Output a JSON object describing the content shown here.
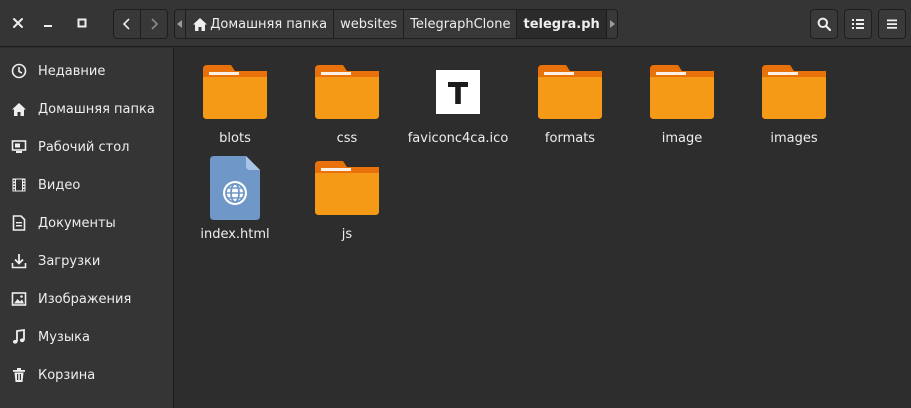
{
  "window": {
    "close_icon": "close-icon",
    "minimize_icon": "minimize-icon",
    "maximize_icon": "maximize-icon"
  },
  "pathbar": {
    "crumbs": [
      {
        "label": "Домашняя папка",
        "icon": "home-icon"
      },
      {
        "label": "websites"
      },
      {
        "label": "TelegraphClone"
      },
      {
        "label": "telegra.ph"
      }
    ]
  },
  "sidebar": {
    "items": [
      {
        "label": "Недавние",
        "icon": "recent-icon"
      },
      {
        "label": "Домашняя папка",
        "icon": "home-icon"
      },
      {
        "label": "Рабочий стол",
        "icon": "desktop-icon"
      },
      {
        "label": "Видео",
        "icon": "video-icon"
      },
      {
        "label": "Документы",
        "icon": "documents-icon"
      },
      {
        "label": "Загрузки",
        "icon": "downloads-icon"
      },
      {
        "label": "Изображения",
        "icon": "pictures-icon"
      },
      {
        "label": "Музыка",
        "icon": "music-icon"
      },
      {
        "label": "Корзина",
        "icon": "trash-icon"
      }
    ]
  },
  "files": [
    {
      "name": "blots",
      "type": "folder"
    },
    {
      "name": "css",
      "type": "folder"
    },
    {
      "name": "faviconc4ca.ico",
      "type": "ico"
    },
    {
      "name": "formats",
      "type": "folder"
    },
    {
      "name": "image",
      "type": "folder"
    },
    {
      "name": "images",
      "type": "folder"
    },
    {
      "name": "index.html",
      "type": "html"
    },
    {
      "name": "js",
      "type": "folder"
    }
  ],
  "colors": {
    "folder": "#f59a17",
    "folder_tab": "#e8710a",
    "html_doc": "#6f98c9"
  }
}
